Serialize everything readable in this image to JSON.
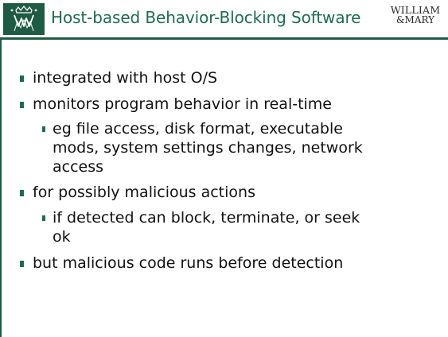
{
  "header": {
    "title": "Host-based Behavior-Blocking Software",
    "brand_line1": "WILLIAM",
    "brand_line2": "&MARY",
    "accent_color": "#1f5a44"
  },
  "bullets": [
    {
      "text": "integrated with host O/S"
    },
    {
      "text": "monitors program behavior in real-time"
    },
    {
      "text": "eg file access, disk format, executable",
      "level": 2
    },
    {
      "text": "mods, system settings changes, network",
      "level": 2
    },
    {
      "text": "access",
      "level": 2
    },
    {
      "text": "for possibly malicious actions"
    },
    {
      "text": "if detected can block, terminate, or seek",
      "level": 2
    },
    {
      "text": "ok",
      "level": 2
    },
    {
      "text": "but malicious code runs before detection"
    }
  ]
}
